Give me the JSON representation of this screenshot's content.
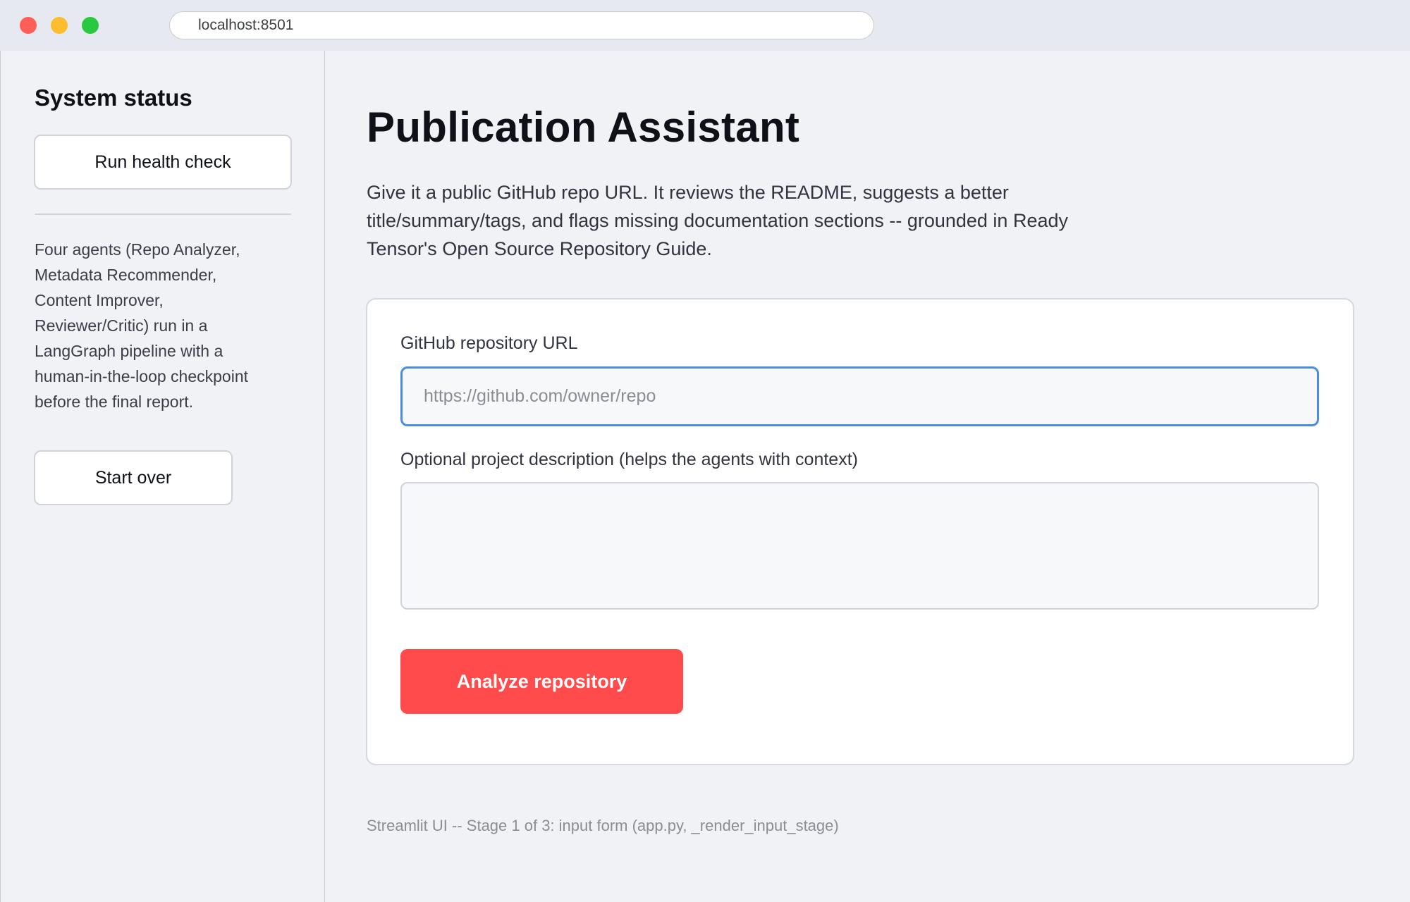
{
  "browser": {
    "url": "localhost:8501"
  },
  "sidebar": {
    "title": "System status",
    "health_button": "Run health check",
    "description": "Four agents (Repo Analyzer, Metadata Recommender, Content Improver, Reviewer/Critic) run in a LangGraph pipeline with a human-in-the-loop checkpoint before the final report.",
    "start_over_button": "Start over"
  },
  "main": {
    "title": "Publication Assistant",
    "intro": "Give it a public GitHub repo URL. It reviews the README, suggests a better title/summary/tags, and flags missing documentation sections -- grounded in Ready Tensor's Open Source Repository Guide.",
    "form": {
      "url_label": "GitHub repository URL",
      "url_placeholder": "https://github.com/owner/repo",
      "url_value": "",
      "desc_label": "Optional project description (helps the agents with context)",
      "desc_value": "",
      "submit_button": "Analyze repository"
    },
    "footer": "Streamlit UI -- Stage 1 of 3: input form (app.py, _render_input_stage)"
  },
  "colors": {
    "accent": "#ff4b4b",
    "focus_border": "#4a8ddc",
    "background": "#f0f2f6"
  }
}
